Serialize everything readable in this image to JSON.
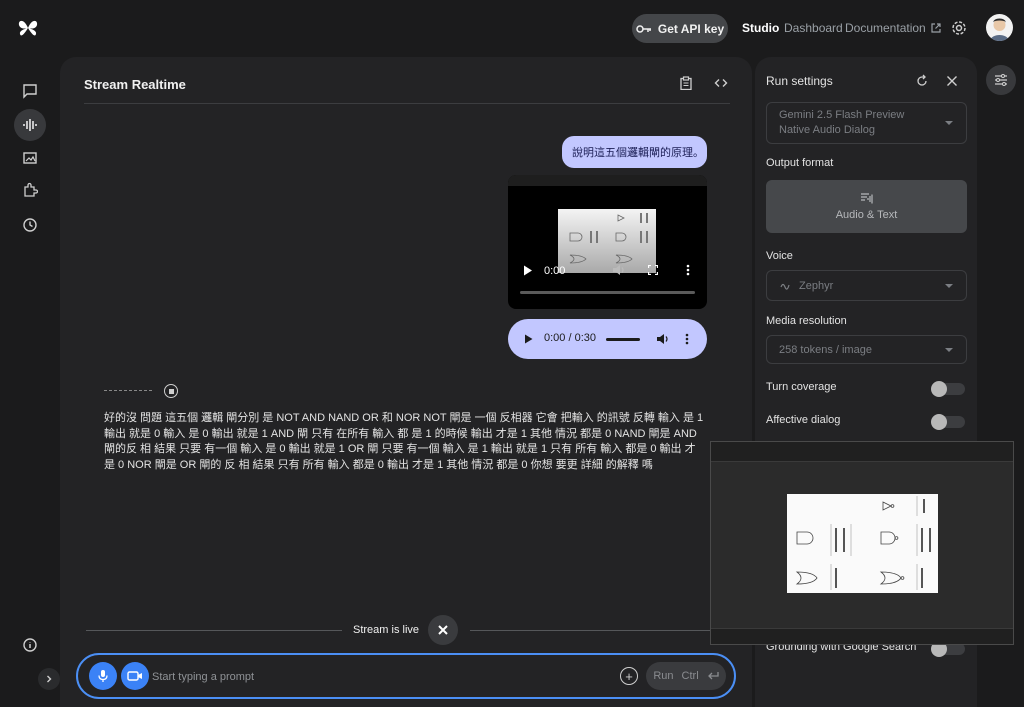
{
  "header": {
    "api_key_label": "Get API key",
    "nav_studio": "Studio",
    "nav_dashboard": "Dashboard",
    "nav_documentation": "Documentation"
  },
  "main": {
    "title": "Stream Realtime",
    "user_message": "說明這五個邏輯閘的原理。",
    "video_time": "0:00",
    "audio_time": "0:00 / 0:30",
    "response_text": "好的沒 問題 這五個 邏輯 閘分別 是 NOT AND NAND OR 和 NOR NOT 閘是 一個 反相器 它會 把輸入 的訊號 反轉 輸入 是 1 輸出 就是 0 輸入 是 0 輸出 就是 1 AND 閘 只有 在所有 輸入 都 是 1 的時候 輸出 才是 1 其他 情況 都是 0 NAND 閘是 AND 閘的反 相 結果 只要 有一個 輸入 是 0 輸出 就是 1 OR 閘 只要 有一個 輸入 是 1 輸出 就是 1 只有 所有 輸入 都是 0 輸出 才是 0 NOR 閘是 OR 閘的 反 相 結果 只有 所有 輸入 都是 0 輸出 才是 1 其他 情況 都是 0 你想 要更 詳細 的解釋 嗎",
    "live_status": "Stream is live",
    "prompt_placeholder": "Start typing a prompt",
    "run_label": "Run",
    "run_shortcut": "Ctrl"
  },
  "settings": {
    "title": "Run settings",
    "model_value": "Gemini 2.5 Flash Preview Native Audio Dialog",
    "output_format_label": "Output format",
    "output_format_value": "Audio & Text",
    "voice_label": "Voice",
    "voice_value": "Zephyr",
    "media_resolution_label": "Media resolution",
    "media_resolution_value": "258 tokens / image",
    "turn_coverage_label": "Turn coverage",
    "affective_dialog_label": "Affective dialog",
    "grounding_label": "Grounding with Google Search"
  },
  "colors": {
    "accent": "#4b8ff5",
    "bubble": "#c2c7ff",
    "panel": "#232325",
    "background": "#1b1b1c"
  }
}
